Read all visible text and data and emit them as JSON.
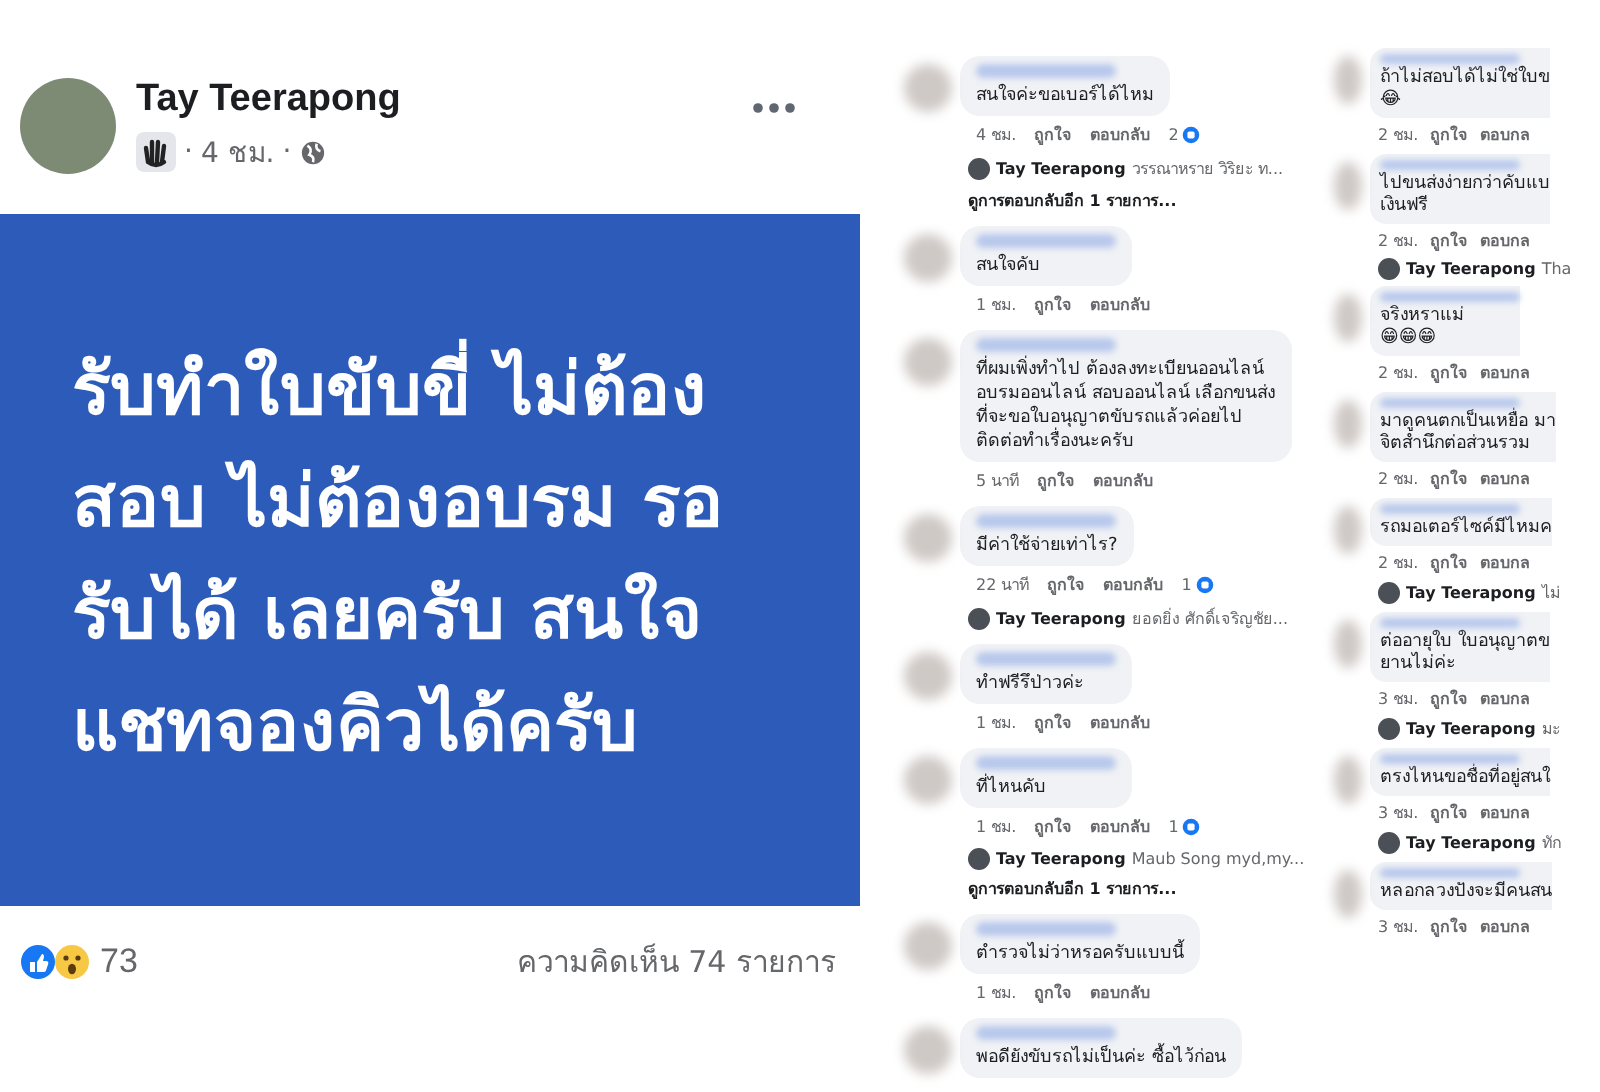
{
  "post": {
    "author": "Tay Teerapong",
    "time": "4 ชม.",
    "separator_1": "·",
    "separator_2": "·",
    "text": "รับทำใบขับขี่ ไม่ต้องสอบ ไม่ต้องอบรม รอรับได้ เลยครับ สนใจแชทจองคิวได้ครับ",
    "reaction_count": "73",
    "comment_count": "ความคิดเห็น 74 รายการ"
  },
  "comment_columns": [
    {
      "comments": [
        {
          "text": "สนใจค่ะขอเบอร์ได้ไหม",
          "time": "4 ชม.",
          "like": "ถูกใจ",
          "reply": "ตอบกลับ",
          "reply_count": "2",
          "replies": [
            {
              "author": "Tay Teerapong",
              "text": "วรรณาหราย วิริยะ ท..."
            }
          ],
          "more": "ดูการตอบกลับอีก 1 รายการ..."
        },
        {
          "text": "สนใจคับ",
          "time": "1 ชม.",
          "like": "ถูกใจ",
          "reply": "ตอบกลับ"
        },
        {
          "text": "ที่ผมเพิ่งทำไป ต้องลงทะเบียนออนไลน์ อบรมออนไลน์ สอบออนไลน์ เลือกขนส่งที่จะขอใบอนุญาตขับรถแล้วค่อยไปติดต่อทำเรื่องนะครับ",
          "time": "5 นาที",
          "like": "ถูกใจ",
          "reply": "ตอบกลับ"
        },
        {
          "text": "มีค่าใช้จ่ายเท่าไร?",
          "time": "22 นาที",
          "like": "ถูกใจ",
          "reply": "ตอบกลับ",
          "reply_count": "1",
          "replies": [
            {
              "author": "Tay Teerapong",
              "text": "ยอดยิ่ง ศักดิ์เจริญชัย..."
            }
          ]
        },
        {
          "text": "ทำฟรีรึป่าวค่ะ",
          "time": "1 ชม.",
          "like": "ถูกใจ",
          "reply": "ตอบกลับ"
        },
        {
          "text": "ที่ไหนคับ",
          "time": "1 ชม.",
          "like": "ถูกใจ",
          "reply": "ตอบกลับ",
          "reply_count": "1",
          "replies": [
            {
              "author": "Tay Teerapong",
              "text": "Maub Song myd,my..."
            }
          ],
          "more": "ดูการตอบกลับอีก 1 รายการ..."
        },
        {
          "text": "ตำรวจไม่ว่าหรอครับแบบนี้",
          "time": "1 ชม.",
          "like": "ถูกใจ",
          "reply": "ตอบกลับ"
        },
        {
          "text": "พอดียังขับรถไม่เป็นค่ะ ซื้อไว้ก่อน"
        }
      ]
    },
    {
      "comments": [
        {
          "text": "ถ้าไม่สอบได้ไม่ใช่ใบข",
          "emoji": "😂",
          "time": "2 ชม.",
          "like": "ถูกใจ",
          "reply": "ตอบกล"
        },
        {
          "text": "ไปขนส่งง่ายกว่าคับแบ",
          "text2": "เงินฟรี",
          "time": "2 ชม.",
          "like": "ถูกใจ",
          "reply": "ตอบกล",
          "replies": [
            {
              "author": "Tay Teerapong",
              "text": "Tha"
            }
          ]
        },
        {
          "text": "จริงหราแม่",
          "emoji": "😁😁😁",
          "time": "2 ชม.",
          "like": "ถูกใจ",
          "reply": "ตอบกล"
        },
        {
          "text": "มาดูคนตกเป็นเหยื่อ มา",
          "text2": "จิตสำนึกต่อส่วนรวม",
          "time": "2 ชม.",
          "like": "ถูกใจ",
          "reply": "ตอบกล"
        },
        {
          "text": "รถมอเตอร์ไซค์มีไหมค",
          "time": "2 ชม.",
          "like": "ถูกใจ",
          "reply": "ตอบกล",
          "replies": [
            {
              "author": "Tay Teerapong",
              "text": "ไม่"
            }
          ]
        },
        {
          "text": "ต่ออายุใบ ใบอนุญาตข",
          "text2": "ยานไม่ค่ะ",
          "time": "3 ชม.",
          "like": "ถูกใจ",
          "reply": "ตอบกล",
          "replies": [
            {
              "author": "Tay Teerapong",
              "text": "มะ"
            }
          ]
        },
        {
          "text": "ตรงไหนขอชื่อที่อยู่สนใ",
          "time": "3 ชม.",
          "like": "ถูกใจ",
          "reply": "ตอบกล",
          "replies": [
            {
              "author": "Tay Teerapong",
              "text": "ทัก"
            }
          ]
        },
        {
          "text": "หลอกลวงปังจะมีคนสน",
          "time": "3 ชม.",
          "like": "ถูกใจ",
          "reply": "ตอบกล"
        }
      ]
    }
  ]
}
